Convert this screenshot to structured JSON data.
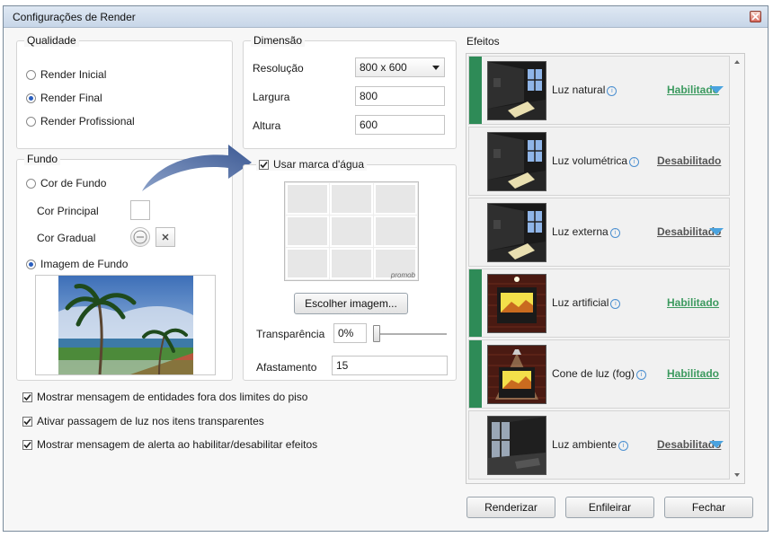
{
  "window": {
    "title": "Configurações de Render"
  },
  "quality": {
    "legend": "Qualidade",
    "options": [
      "Render Inicial",
      "Render Final",
      "Render Profissional"
    ],
    "selected": "Render Final"
  },
  "dimension": {
    "legend": "Dimensão",
    "resolution_label": "Resolução",
    "resolution_value": "800 x 600",
    "width_label": "Largura",
    "width_value": "800",
    "height_label": "Altura",
    "height_value": "600"
  },
  "background": {
    "legend": "Fundo",
    "color_option": "Cor de Fundo",
    "main_color_label": "Cor Principal",
    "gradient_color_label": "Cor Gradual",
    "image_option": "Imagem de Fundo",
    "selected": "Imagem de Fundo"
  },
  "watermark": {
    "checkbox_label": "Usar marca d'água",
    "checked": true,
    "preview_text": "promob",
    "choose_button": "Escolher imagem...",
    "transparency_label": "Transparência",
    "transparency_value": "0%",
    "transparency_fraction": 0,
    "distance_label": "Afastamento",
    "distance_value": "15"
  },
  "options": [
    {
      "label": "Mostrar mensagem de entidades fora dos limites do piso",
      "checked": true
    },
    {
      "label": "Ativar passagem de luz nos itens transparentes",
      "checked": true
    },
    {
      "label": "Mostrar mensagem de alerta ao habilitar/desabilitar efeitos",
      "checked": true
    }
  ],
  "effects": {
    "label": "Efeitos",
    "items": [
      {
        "name": "Luz natural",
        "status": "Habilitado",
        "enabled": true,
        "expandable": true,
        "thumb": "room-natural"
      },
      {
        "name": "Luz volumétrica",
        "status": "Desabilitado",
        "enabled": false,
        "expandable": false,
        "thumb": "room-natural"
      },
      {
        "name": "Luz externa",
        "status": "Desabilitado",
        "enabled": false,
        "expandable": true,
        "thumb": "room-natural"
      },
      {
        "name": "Luz artificial",
        "status": "Habilitado",
        "enabled": true,
        "expandable": false,
        "thumb": "artificial"
      },
      {
        "name": "Cone de luz (fog)",
        "status": "Habilitado",
        "enabled": true,
        "expandable": false,
        "thumb": "cone"
      },
      {
        "name": "Luz ambiente",
        "status": "Desabilitado",
        "enabled": false,
        "expandable": true,
        "thumb": "ambient"
      }
    ]
  },
  "buttons": {
    "render": "Renderizar",
    "queue": "Enfileirar",
    "close": "Fechar"
  },
  "colors": {
    "enabled": "#2e8b57",
    "enabled_text": "#3c9a5f",
    "disabled_text": "#555555",
    "expand_arrow": "#4aa3df",
    "arrow_fill": "#5b73a3"
  }
}
